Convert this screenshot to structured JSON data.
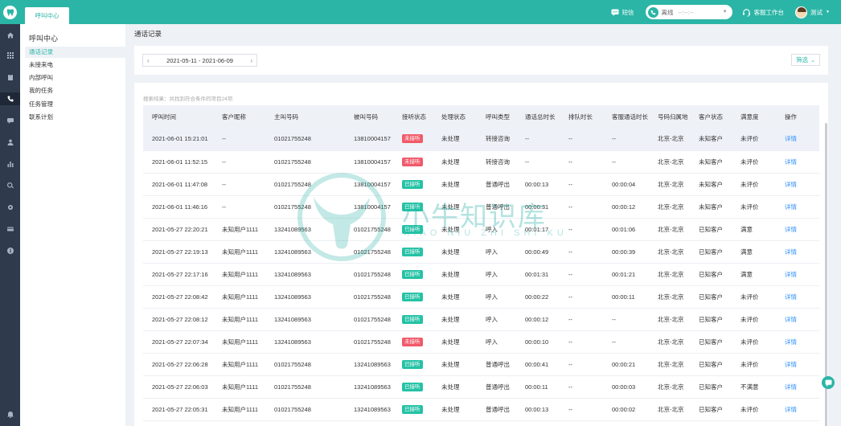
{
  "header": {
    "tab_label": "呼叫中心",
    "sms_label": "短信",
    "status_label": "离线",
    "status_value": "--:--:--",
    "workbench_label": "客服工作台",
    "user_name": "测试"
  },
  "sidebar": {
    "title": "呼叫中心",
    "items": [
      {
        "label": "通话记录"
      },
      {
        "label": "未接来电"
      },
      {
        "label": "内部呼叫"
      },
      {
        "label": "我的任务"
      },
      {
        "label": "任务管理"
      },
      {
        "label": "联系计划"
      }
    ]
  },
  "main": {
    "title": "通话记录",
    "date_range": "2021-05-11 - 2021-06-09",
    "filter_label": "筛选",
    "result_text": "搜索结果：共找到符合条件的项目24项",
    "columns": [
      "呼叫时间",
      "客户昵称",
      "主叫号码",
      "被叫号码",
      "接听状态",
      "处理状态",
      "呼叫类型",
      "通话总时长",
      "排队时长",
      "客服通话时长",
      "号码归属地",
      "客户状态",
      "满意度",
      "操作"
    ],
    "rows": [
      [
        "2021-06-01 15:21:01",
        "--",
        "01021755248",
        "13810004157",
        "未接听",
        "未处理",
        "转接咨询",
        "--",
        "--",
        "--",
        "北京-北京",
        "未知客户",
        "未评价",
        "详情"
      ],
      [
        "2021-06-01 11:52:15",
        "--",
        "01021755248",
        "13810004157",
        "未接听",
        "未处理",
        "转接咨询",
        "--",
        "--",
        "--",
        "北京-北京",
        "未知客户",
        "未评价",
        "详情"
      ],
      [
        "2021-06-01 11:47:08",
        "--",
        "01021755248",
        "13810004157",
        "已接听",
        "未处理",
        "普通呼出",
        "00:00:13",
        "--",
        "00:00:04",
        "北京-北京",
        "未知客户",
        "未评价",
        "详情"
      ],
      [
        "2021-06-01 11:46:16",
        "--",
        "01021755248",
        "13810004157",
        "已接听",
        "未处理",
        "普通呼出",
        "00:00:31",
        "--",
        "00:00:12",
        "北京-北京",
        "未知客户",
        "未评价",
        "详情"
      ],
      [
        "2021-05-27 22:20:21",
        "未知用户1111",
        "13241089563",
        "01021755248",
        "已接听",
        "未处理",
        "呼入",
        "00:01:17",
        "--",
        "00:01:06",
        "北京-北京",
        "已知客户",
        "满意",
        "详情"
      ],
      [
        "2021-05-27 22:19:13",
        "未知用户1111",
        "13241089563",
        "01021755248",
        "已接听",
        "未处理",
        "呼入",
        "00:00:49",
        "--",
        "00:00:39",
        "北京-北京",
        "已知客户",
        "满意",
        "详情"
      ],
      [
        "2021-05-27 22:17:16",
        "未知用户1111",
        "13241089563",
        "01021755248",
        "已接听",
        "未处理",
        "呼入",
        "00:01:31",
        "--",
        "00:01:21",
        "北京-北京",
        "已知客户",
        "满意",
        "详情"
      ],
      [
        "2021-05-27 22:08:42",
        "未知用户1111",
        "13241089563",
        "01021755248",
        "已接听",
        "未处理",
        "呼入",
        "00:00:22",
        "--",
        "00:00:11",
        "北京-北京",
        "已知客户",
        "未评价",
        "详情"
      ],
      [
        "2021-05-27 22:08:12",
        "未知用户1111",
        "13241089563",
        "01021755248",
        "已接听",
        "未处理",
        "呼入",
        "00:00:12",
        "--",
        "--",
        "北京-北京",
        "已知客户",
        "未评价",
        "详情"
      ],
      [
        "2021-05-27 22:07:34",
        "未知用户1111",
        "13241089563",
        "01021755248",
        "未接听",
        "未处理",
        "呼入",
        "00:00:10",
        "--",
        "--",
        "北京-北京",
        "已知客户",
        "未评价",
        "详情"
      ],
      [
        "2021-05-27 22:06:28",
        "未知用户1111",
        "01021755248",
        "13241089563",
        "已接听",
        "未处理",
        "普通呼出",
        "00:00:41",
        "--",
        "00:00:21",
        "北京-北京",
        "已知客户",
        "未评价",
        "详情"
      ],
      [
        "2021-05-27 22:06:03",
        "未知用户1111",
        "01021755248",
        "13241089563",
        "已接听",
        "未处理",
        "普通呼出",
        "00:00:11",
        "--",
        "00:00:03",
        "北京-北京",
        "已知客户",
        "不满意",
        "详情"
      ],
      [
        "2021-05-27 22:05:31",
        "未知用户1111",
        "01021755248",
        "13241089563",
        "已接听",
        "未处理",
        "普通呼出",
        "00:00:13",
        "--",
        "00:00:02",
        "北京-北京",
        "已知客户",
        "未评价",
        "详情"
      ]
    ]
  },
  "watermark": {
    "text": "小牛知识库",
    "sub": "XIAO NIU ZHI SHI KU"
  },
  "colors": {
    "brand": "#2bb5a6",
    "missed": "#f15a6a",
    "answered": "#24c2a5",
    "link": "#2c8ef8",
    "rail": "#2f3b4c"
  }
}
